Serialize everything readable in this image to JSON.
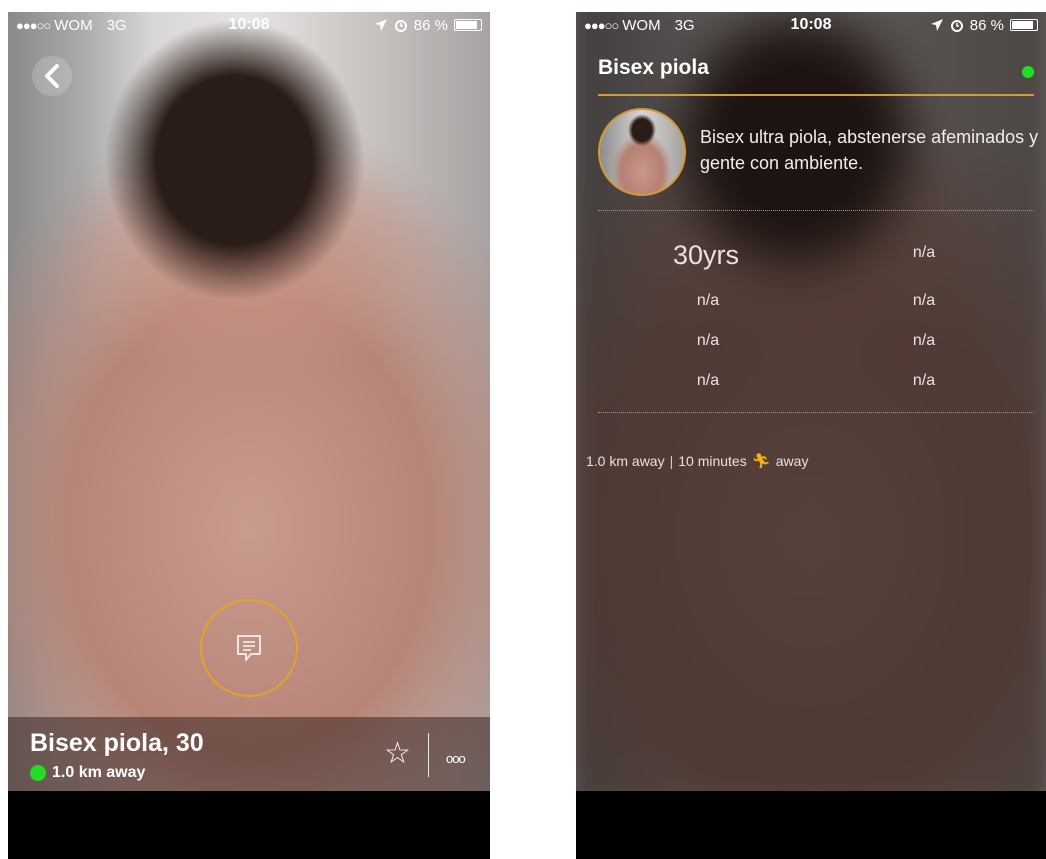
{
  "status_bar": {
    "signal_dots": "●●●○○",
    "carrier": "WOM",
    "network": "3G",
    "time": "10:08",
    "battery": "86 %"
  },
  "profile_screen": {
    "name_age": "Bisex piola, 30",
    "distance": "1.0 km away",
    "more_label": "ooo"
  },
  "details_screen": {
    "title": "Bisex piola",
    "bio": "Bisex ultra piola, abstenerse afeminados y gente con ambiente.",
    "stats": {
      "age": "30yrs",
      "col2_row1": "n/a",
      "col1_row2": "n/a",
      "col2_row2": "n/a",
      "col1_row3": "n/a",
      "col2_row3": "n/a",
      "col1_row4": "n/a",
      "col2_row4": "n/a"
    },
    "footer": {
      "distance": "1.0 km away",
      "separator": "|",
      "travel_time": "10 minutes",
      "away_label": "away"
    }
  },
  "colors": {
    "accent": "#d49a35",
    "online": "#22dd22",
    "walk_icon": "#f2b21a"
  },
  "icons": [
    "back-chevron-icon",
    "chat-icon",
    "star-icon",
    "location-arrow-icon",
    "alarm-icon",
    "battery-icon",
    "walking-person-icon"
  ]
}
